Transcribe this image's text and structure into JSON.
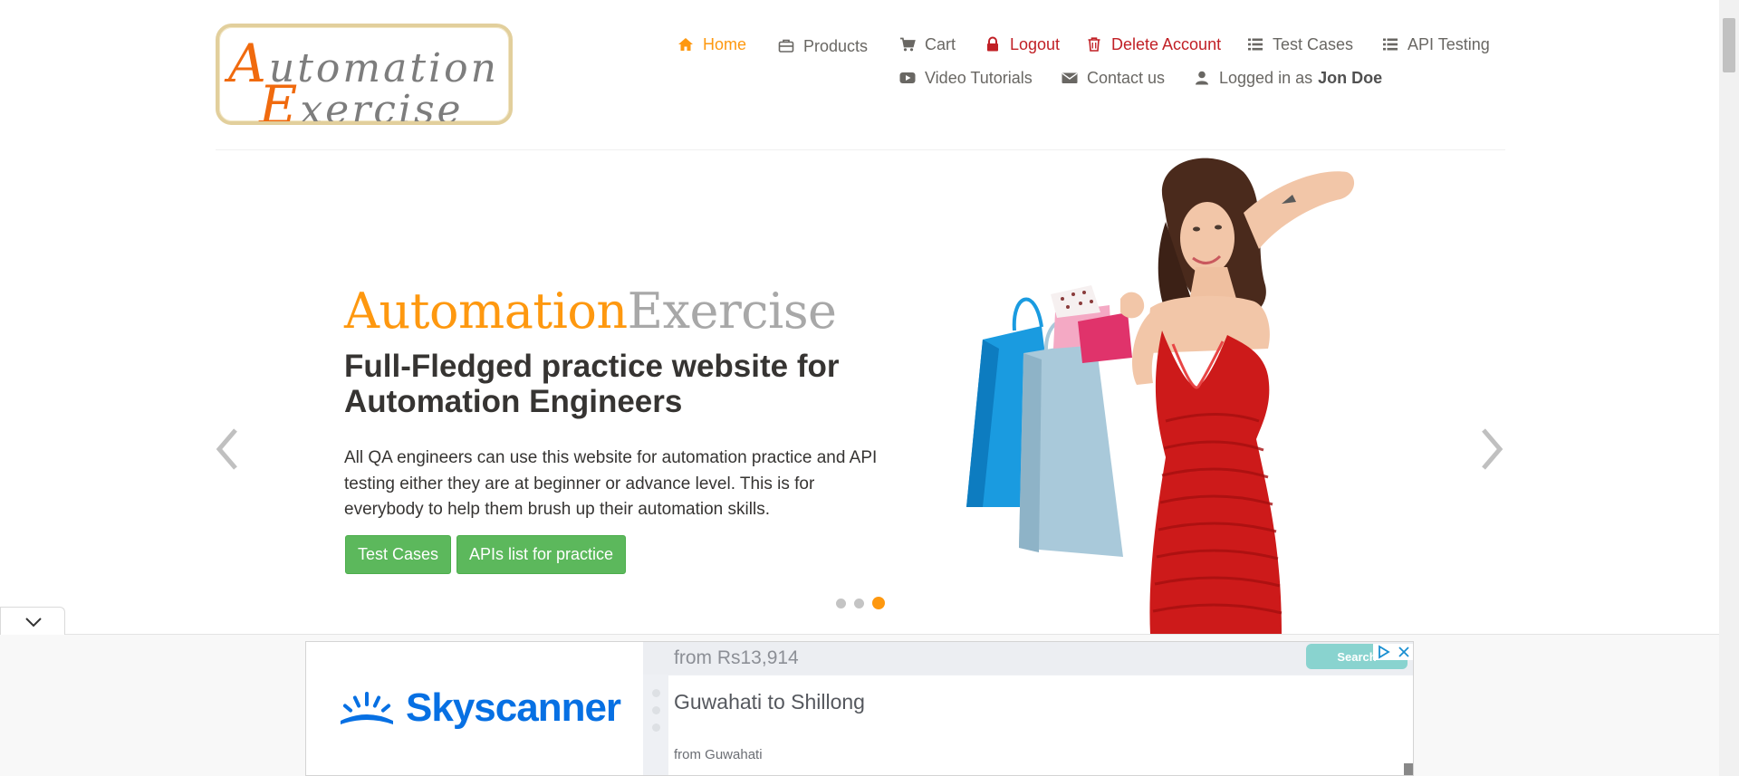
{
  "logo": {
    "line1_cap": "A",
    "line1_rest": "utomation",
    "line2_cap": "E",
    "line2_rest": "xercise"
  },
  "nav": {
    "home": "Home",
    "products": "Products",
    "cart": "Cart",
    "logout": "Logout",
    "delete_account": "Delete Account",
    "test_cases": "Test Cases",
    "api_testing": "API Testing",
    "video_tutorials": "Video Tutorials",
    "contact_us": "Contact us",
    "logged_in_prefix": "Logged in as",
    "logged_in_user": "Jon Doe"
  },
  "hero": {
    "brand_part1": "Automation",
    "brand_part2": "Exercise",
    "title": "Full-Fledged practice website for Automation Engineers",
    "text": "All QA engineers can use this website for automation practice and API testing either they are at beginner or advance level. This is for everybody to help them brush up their automation skills.",
    "button_test_cases": "Test Cases",
    "button_apis": "APIs list for practice",
    "active_slide": 3,
    "slide_count": 3
  },
  "ad": {
    "brand": "Skyscanner",
    "price": "from Rs13,914",
    "route": "Guwahati to Shillong",
    "from": "from Guwahati",
    "search": "Search"
  },
  "colors": {
    "accent": "#fe980f",
    "danger": "#c12026",
    "button_green": "#5cb85c",
    "skyscanner_blue": "#0770e3"
  },
  "icons": {
    "home": "home-icon",
    "products": "briefcase-icon",
    "cart": "cart-icon",
    "logout": "lock-icon",
    "delete": "trash-icon",
    "test_cases": "list-icon",
    "api_testing": "list-icon",
    "video": "youtube-play-icon",
    "contact": "envelope-icon",
    "user": "user-icon"
  }
}
